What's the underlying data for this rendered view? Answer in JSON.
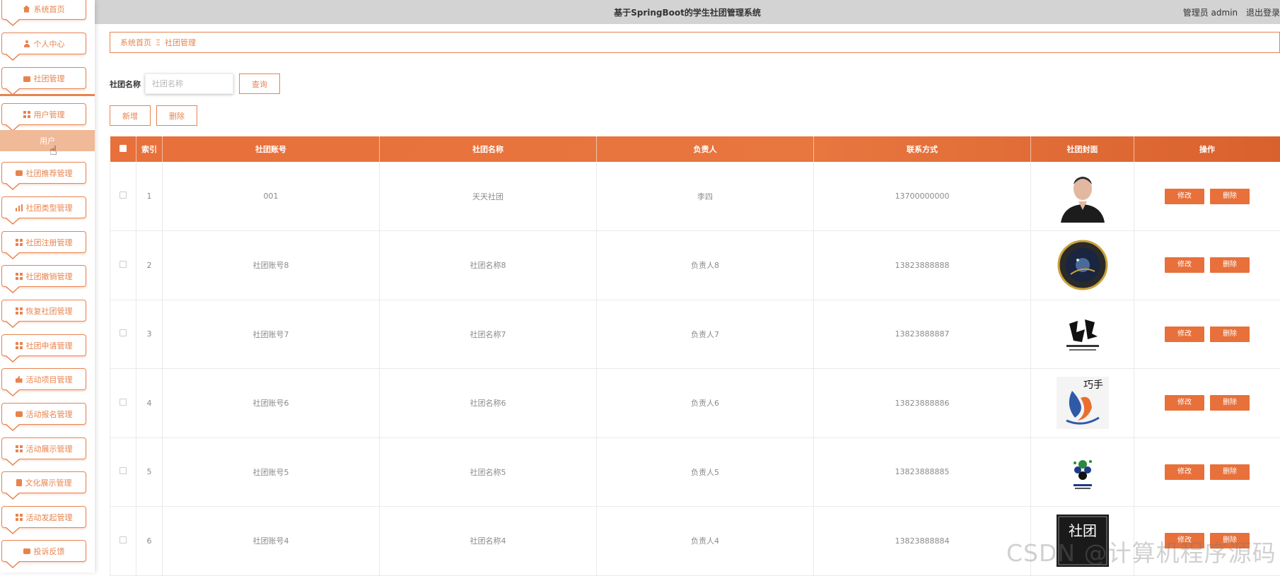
{
  "header": {
    "title": "基于SpringBoot的学生社团管理系统",
    "user_label": "管理员 admin",
    "logout_label": "退出登录"
  },
  "sidebar": {
    "items": [
      {
        "label": "系统首页",
        "icon": "home-icon"
      },
      {
        "label": "个人中心",
        "icon": "user-icon"
      },
      {
        "label": "社团管理",
        "icon": "briefcase-icon"
      },
      {
        "label": "用户管理",
        "icon": "grid-icon"
      },
      {
        "label": "社团推荐管理",
        "icon": "chat-icon"
      },
      {
        "label": "社团类型管理",
        "icon": "bar-chart-icon"
      },
      {
        "label": "社团注册管理",
        "icon": "grid-icon"
      },
      {
        "label": "社团撤销管理",
        "icon": "grid-icon"
      },
      {
        "label": "恢复社团管理",
        "icon": "grid-icon"
      },
      {
        "label": "社团申请管理",
        "icon": "grid-icon"
      },
      {
        "label": "活动项目管理",
        "icon": "thumb-icon"
      },
      {
        "label": "活动报名管理",
        "icon": "chat-icon"
      },
      {
        "label": "活动展示管理",
        "icon": "bowtie-icon"
      },
      {
        "label": "文化展示管理",
        "icon": "clipboard-icon"
      },
      {
        "label": "活动发起管理",
        "icon": "grid-icon"
      },
      {
        "label": "投诉反馈",
        "icon": "chat-icon"
      }
    ],
    "sub_item": "用户"
  },
  "breadcrumb": {
    "home": "系统首页",
    "separator": "Ξ",
    "current": "社团管理"
  },
  "search": {
    "label": "社团名称",
    "placeholder": "社团名称",
    "button": "查询"
  },
  "actions": {
    "add": "新增",
    "delete": "删除"
  },
  "table": {
    "columns": [
      "索引",
      "社团账号",
      "社团名称",
      "负责人",
      "联系方式",
      "社团封面",
      "操作"
    ],
    "rows": [
      {
        "index": "1",
        "account": "001",
        "name": "天天社团",
        "leader": "李四",
        "phone": "13700000000",
        "cover": "portrait-photo"
      },
      {
        "index": "2",
        "account": "社团账号8",
        "name": "社团名称8",
        "leader": "负责人8",
        "phone": "13823888888",
        "cover": "astronomy-club-logo"
      },
      {
        "index": "3",
        "account": "社团账号7",
        "name": "社团名称7",
        "leader": "负责人7",
        "phone": "13823888887",
        "cover": "calligraphy-club-logo"
      },
      {
        "index": "4",
        "account": "社团账号6",
        "name": "社团名称6",
        "leader": "负责人6",
        "phone": "13823888886",
        "cover": "handcraft-club-logo"
      },
      {
        "index": "5",
        "account": "社团账号5",
        "name": "社团名称5",
        "leader": "负责人5",
        "phone": "13823888885",
        "cover": "sports-club-logo"
      },
      {
        "index": "6",
        "account": "社团账号4",
        "name": "社团名称4",
        "leader": "负责人4",
        "phone": "13823888884",
        "cover": "club-text-logo"
      }
    ],
    "edit_label": "修改",
    "delete_label": "删除"
  },
  "cover_texts": {
    "handcraft": "巧手",
    "club_text": "社团"
  },
  "watermark": "CSDN @计算机程序源码",
  "colors": {
    "accent": "#e8834e",
    "header_bar": "#d3d3d3",
    "table_header": "#e8703a"
  }
}
